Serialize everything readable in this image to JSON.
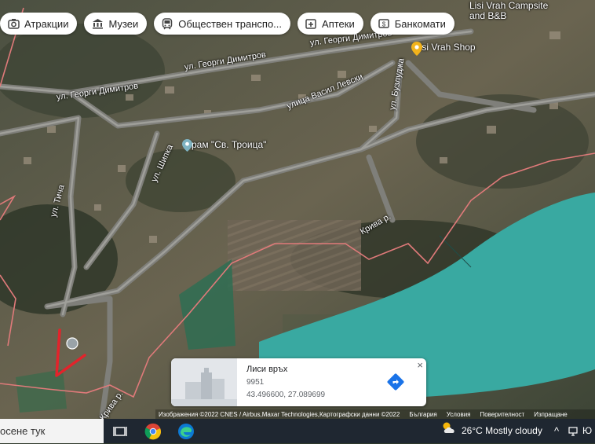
{
  "chips": [
    {
      "label": "Атракции",
      "icon": "camera-icon"
    },
    {
      "label": "Музеи",
      "icon": "museum-icon"
    },
    {
      "label": "Обществен транспо...",
      "icon": "transit-icon"
    },
    {
      "label": "Аптеки",
      "icon": "pharmacy-icon"
    },
    {
      "label": "Банкомати",
      "icon": "atm-icon"
    }
  ],
  "map": {
    "streets": [
      "ул. Георги Димитров",
      "ул. Георги Димитров",
      "ул. Георги Димитров",
      "улица Васил Левски",
      "ул. Бузлуджа",
      "ул. Шипка",
      "ул. Тича",
      "Крива р.",
      "Крива р."
    ],
    "pois": [
      {
        "label": "Храм \"Св. Троица\"",
        "icon": "place-marker-icon",
        "color": "#7fb3c2"
      },
      {
        "label": "Lisi Vrah Shop",
        "icon": "shop-marker-icon",
        "color": "#f2b31c"
      },
      {
        "label": "Lisi Vrah Campsite and B&B",
        "icon": "",
        "color": "#ffffff"
      }
    ],
    "water_color": "#39a9a1",
    "boundary_color": "#e07a7a"
  },
  "place_card": {
    "title": "Лиси връх",
    "postal_code": "9951",
    "coordinates": "43.496600, 27.089699",
    "close": "×"
  },
  "attribution": {
    "imagery": "Изображения ©2022 CNES / Airbus,Maxar Technologies,Картографски данни ©2022",
    "country": "България",
    "terms": "Условия",
    "privacy": "Поверителност",
    "send": "Изпращане"
  },
  "taskbar": {
    "search_text": "осене тук",
    "weather": "26°C  Mostly cloudy",
    "tray_extra": "^",
    "tray_lang": "Ю"
  }
}
